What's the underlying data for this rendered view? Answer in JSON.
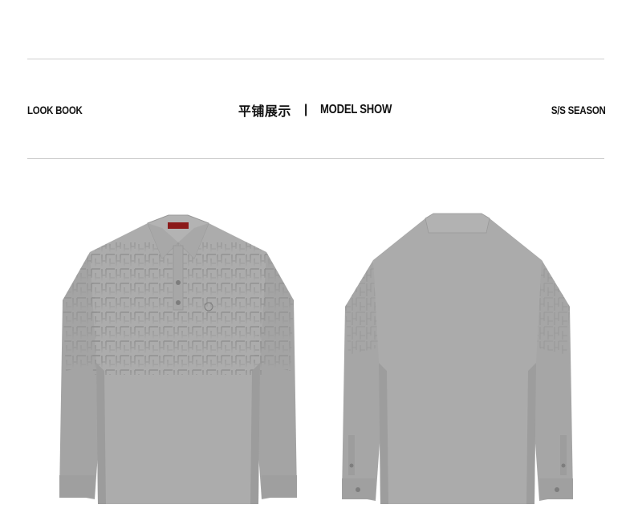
{
  "header": {
    "left_label": "LOOK BOOK",
    "center_cn": "平铺展示",
    "center_separator": "|",
    "center_en": "MODEL SHOW",
    "right_label": "S/S SEASON"
  },
  "images": {
    "front": "grey-long-sleeve-polo-front",
    "back": "grey-long-sleeve-polo-back"
  },
  "colors": {
    "shirt": "#a9a9a9",
    "shirt_shadow": "#9a9a9a",
    "pattern": "#9b9b9b",
    "rule": "#cfcfcf",
    "label": "#8b1a1a"
  }
}
